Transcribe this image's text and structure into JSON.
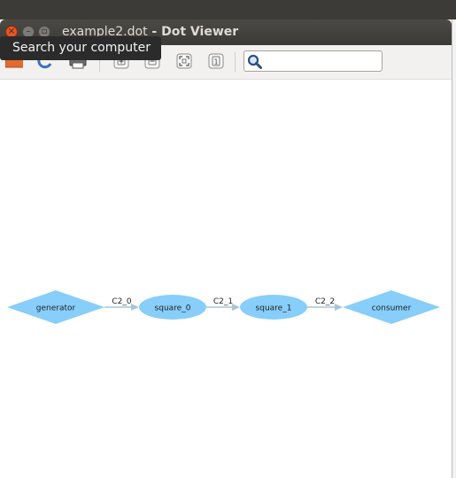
{
  "window": {
    "file_name": "example2.dot",
    "separator": " - ",
    "app_name": "Dot Viewer"
  },
  "toolbar": {
    "buttons": [
      {
        "icon": "open-folder-icon"
      },
      {
        "icon": "reload-icon"
      },
      {
        "icon": "print-icon"
      },
      {
        "icon": "zoom-in-icon"
      },
      {
        "icon": "zoom-out-icon"
      },
      {
        "icon": "zoom-fit-icon"
      },
      {
        "icon": "zoom-100-icon",
        "glyph": "1"
      }
    ],
    "search": {
      "value": "",
      "placeholder": "",
      "icon": "magnifier-icon"
    }
  },
  "tooltip": {
    "text": "Search your computer"
  },
  "graph": {
    "node_fill": "#87cefa",
    "edge_color": "#a9c6d6",
    "nodes": [
      {
        "id": "generator",
        "label": "generator",
        "shape": "diamond"
      },
      {
        "id": "square_0",
        "label": "square_0",
        "shape": "ellipse"
      },
      {
        "id": "square_1",
        "label": "square_1",
        "shape": "ellipse"
      },
      {
        "id": "consumer",
        "label": "consumer",
        "shape": "diamond"
      }
    ],
    "edges": [
      {
        "from": "generator",
        "to": "square_0",
        "label": "C2_0"
      },
      {
        "from": "square_0",
        "to": "square_1",
        "label": "C2_1"
      },
      {
        "from": "square_1",
        "to": "consumer",
        "label": "C2_2"
      }
    ]
  }
}
